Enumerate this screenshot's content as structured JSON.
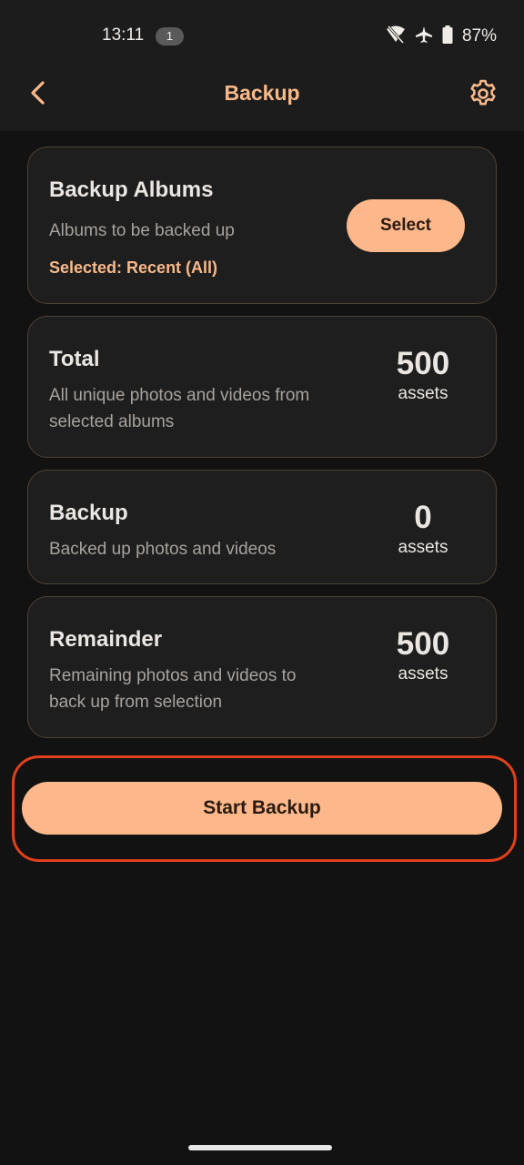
{
  "status_bar": {
    "time": "13:11",
    "notification_count": "1",
    "battery": "87%",
    "icons": [
      "wifi-off-icon",
      "airplane-icon",
      "battery-icon"
    ]
  },
  "app_bar": {
    "title": "Backup",
    "back_icon": "chevron-left-icon",
    "settings_icon": "gear-icon"
  },
  "albums_card": {
    "title": "Backup Albums",
    "subtitle": "Albums to be backed up",
    "selected": "Selected: Recent (All)",
    "select_label": "Select"
  },
  "total_card": {
    "title": "Total",
    "subtitle_line1": "All unique photos and videos from",
    "subtitle_line2": "selected albums",
    "count": "500",
    "unit": "assets"
  },
  "backup_card": {
    "title": "Backup",
    "subtitle": "Backed up photos and videos",
    "count": "0",
    "unit": "assets"
  },
  "remainder_card": {
    "title": "Remainder",
    "subtitle_line1": "Remaining photos and videos to",
    "subtitle_line2": "back up from selection",
    "count": "500",
    "unit": "assets"
  },
  "start_button": {
    "label": "Start Backup"
  },
  "colors": {
    "accent": "#fcb88a",
    "accent_text": "#f8b98a",
    "background": "#121212",
    "card": "#1e1e1e",
    "highlight": "#e2401c"
  }
}
